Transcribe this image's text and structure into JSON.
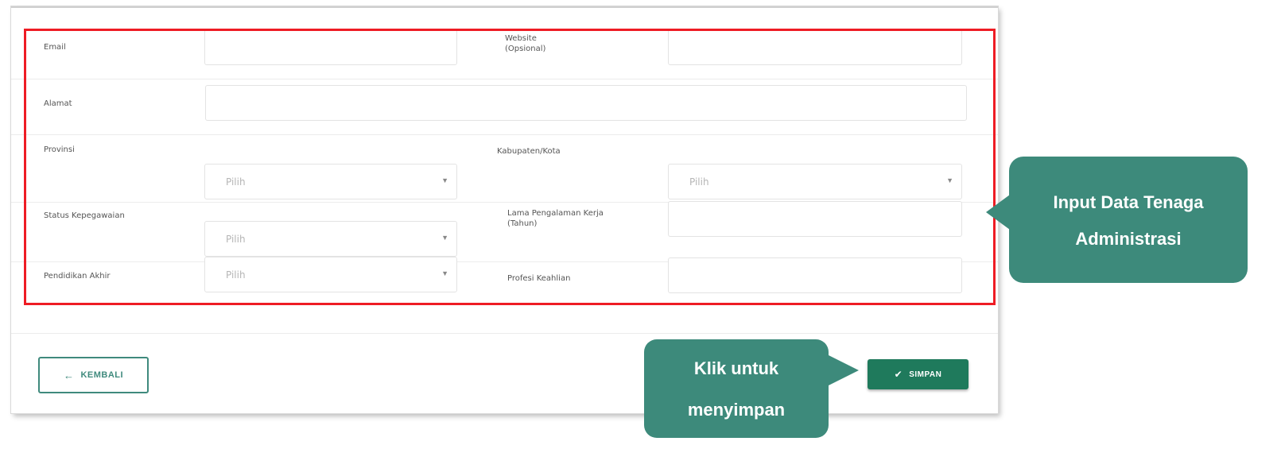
{
  "form": {
    "email_label": "Email",
    "website_label": "Website\n(Opsional)",
    "alamat_label": "Alamat",
    "provinsi_label": "Provinsi",
    "provinsi_value": "Pilih",
    "kabupaten_label": "Kabupaten/Kota",
    "kabupaten_value": "Pilih",
    "status_label": "Status Kepegawaian",
    "status_value": "Pilih",
    "pengalaman_label": "Lama Pengalaman Kerja\n(Tahun)",
    "pendidikan_label": "Pendidikan Akhir",
    "pendidikan_value": "Pilih",
    "profesi_label": "Profesi Keahlian"
  },
  "buttons": {
    "back_label": "KEMBALI",
    "save_label": "SIMPAN"
  },
  "callouts": {
    "input": {
      "line1": "Input Data Tenaga",
      "line2": "Administrasi"
    },
    "save": {
      "line1": "Klik untuk",
      "line2": "menyimpan"
    }
  },
  "colors": {
    "accent": "#3d8a7b",
    "save_button": "#1f7a5c",
    "highlight": "#ee1c24"
  },
  "icons": {
    "back": "arrow-left-icon",
    "save": "check-icon",
    "dropdown": "caret-down-icon"
  }
}
